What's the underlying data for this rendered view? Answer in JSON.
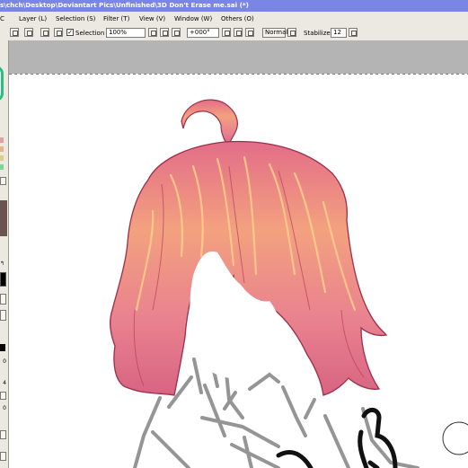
{
  "window": {
    "title": "s\\chch\\Desktop\\Deviantart Pics\\Unfinished\\3D Don't Erase me.sai (*)"
  },
  "menu": {
    "items": [
      {
        "label": "Layer (L)"
      },
      {
        "label": "Selection (S)"
      },
      {
        "label": "Filter (T)"
      },
      {
        "label": "View (V)"
      },
      {
        "label": "Window (W)"
      },
      {
        "label": "Others (O)"
      }
    ]
  },
  "toolbar": {
    "selection_label": "Selection",
    "selection_checked": true,
    "zoom_value": "100%",
    "rotation_value": "+000°",
    "blend_mode": "Normal",
    "stabilizer_label": "Stabilizer",
    "stabilizer_value": "12"
  },
  "left_panel": {
    "numbers": [
      "0",
      "4",
      "0"
    ]
  },
  "colors": {
    "titlebar": "#7a86e6",
    "chrome": "#ece9e2",
    "canvas_outside": "#b4b4b4",
    "hair_base": "#e57f94",
    "hair_highlight": "#f8b47c",
    "hair_line": "#9a2f4a",
    "sketch_gray": "#8a8a8a"
  },
  "icons": {
    "toolbar": [
      "undo-icon",
      "redo-icon",
      "deselect-icon",
      "select-all-icon",
      "zoom-out-icon",
      "zoom-in-icon",
      "zoom-reset-icon",
      "rotate-left-icon",
      "rotate-right-icon",
      "rotate-reset-icon",
      "flip-icon"
    ]
  }
}
